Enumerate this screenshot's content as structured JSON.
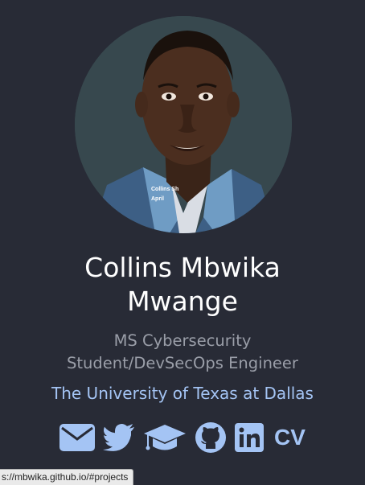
{
  "profile": {
    "photo_stamp_line1": "Collins Sh",
    "photo_stamp_line2": "April"
  },
  "name": {
    "line1": "Collins Mbwika",
    "line2": "Mwange"
  },
  "title": {
    "line1": "MS Cybersecurity",
    "line2": "Student/DevSecOps Engineer"
  },
  "university": "The University of Texas at Dallas",
  "social": {
    "icons": [
      "envelope-icon",
      "twitter-icon",
      "graduation-cap-icon",
      "github-icon",
      "linkedin-icon"
    ],
    "cv_label": "CV"
  },
  "status_bar": {
    "url": "s://mbwika.github.io/#projects"
  },
  "colors": {
    "background": "#282b36",
    "accent": "#a4c4f4",
    "name": "#ffffff",
    "subtitle": "#9a9ea8"
  }
}
